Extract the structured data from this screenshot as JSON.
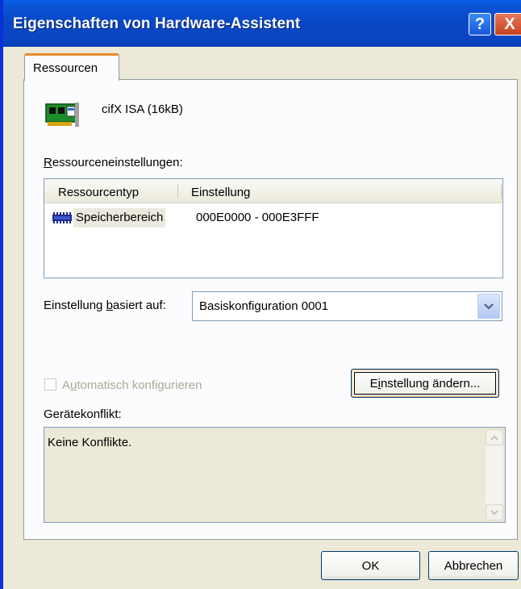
{
  "window": {
    "title": "Eigenschaften von Hardware-Assistent",
    "help_button": "?",
    "close_button": "X"
  },
  "tabs": [
    {
      "label": "Ressourcen",
      "active": true
    }
  ],
  "device": {
    "icon": "pci-card-icon",
    "name": "cifX ISA (16kB)"
  },
  "resource_settings": {
    "label_accel": "R",
    "label_rest": "essourceneinstellungen:",
    "columns": [
      "Ressourcentyp",
      "Einstellung"
    ],
    "rows": [
      {
        "icon": "memory-chip-icon",
        "type": "Speicherbereich",
        "setting": "000E0000 - 000E3FFF"
      }
    ]
  },
  "based_on": {
    "label_pre": "Einstellung ",
    "label_accel": "b",
    "label_post": "asiert auf:",
    "value": "Basiskonfiguration 0001"
  },
  "auto_config": {
    "label_pre": "A",
    "label_accel": "u",
    "label_post": "tomatisch konfigurieren",
    "checked": false,
    "enabled": false
  },
  "change_button": {
    "pre": "E",
    "accel": "i",
    "post": "nstellung ändern..."
  },
  "conflict": {
    "label": "Gerätekonflikt:",
    "text": "Keine Konflikte."
  },
  "buttons": {
    "ok": "OK",
    "cancel": "Abbrechen"
  },
  "colors": {
    "titlebar": "#0a46c1",
    "dialog_bg": "#ece9d8",
    "tab_accent": "#e68b2c"
  }
}
